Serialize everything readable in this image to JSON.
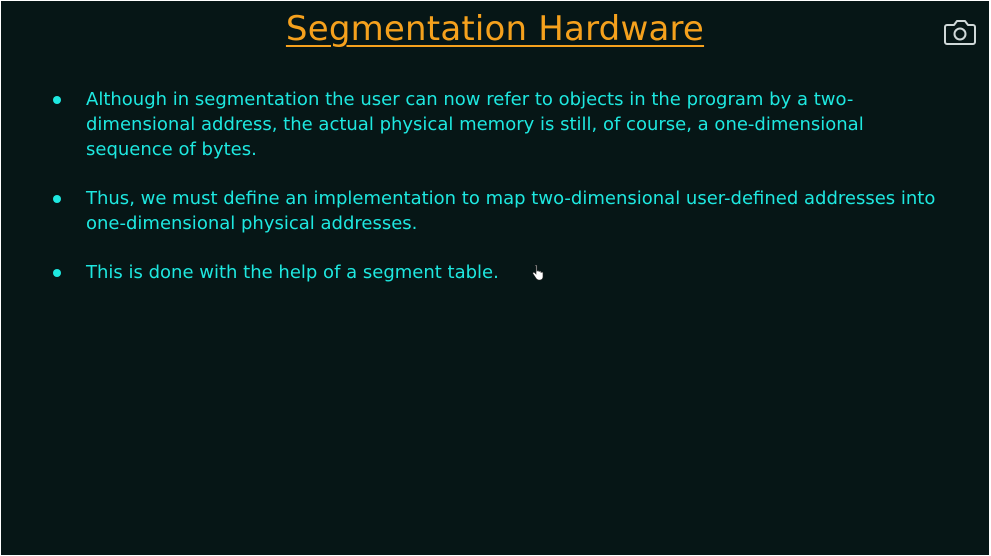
{
  "slide": {
    "title": "Segmentation Hardware",
    "bullets": [
      "Although in segmentation the user can now refer to objects in the program by a two-dimensional address, the actual physical memory is still, of course, a one-dimensional sequence of bytes.",
      "Thus, we must define an implementation to map two-dimensional user-defined addresses into one-dimensional physical addresses.",
      "This is done with the help of a segment table."
    ]
  },
  "icons": {
    "camera": "camera-icon",
    "cursor": "hand-pointer-icon"
  },
  "colors": {
    "background": "#061616",
    "title": "#f5a11d",
    "text": "#1ee8e0",
    "icon": "#cfd8d8"
  }
}
